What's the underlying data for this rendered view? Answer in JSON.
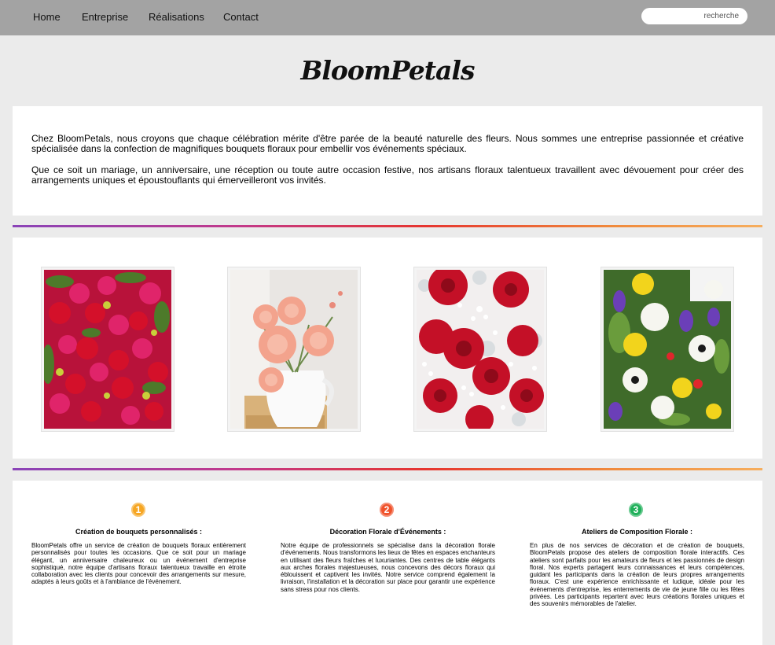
{
  "nav": {
    "items": [
      {
        "label": "Home"
      },
      {
        "label": "Entreprise"
      },
      {
        "label": "Réalisations"
      },
      {
        "label": "Contact"
      }
    ],
    "search_placeholder": "recherche"
  },
  "brand": {
    "name": "BloomPetals"
  },
  "intro": {
    "paragraphs": [
      "Chez BloomPetals, nous croyons que chaque célébration mérite d'être parée de la beauté naturelle des fleurs. Nous sommes une entreprise passionnée et créative spécialisée dans la confection de magnifiques bouquets floraux pour embellir vos événements spéciaux.",
      "Que ce soit un mariage, un anniversaire, une réception ou toute autre occasion festive, nos artisans floraux talentueux travaillent avec dévouement pour créer des arrangements uniques et époustouflants qui émerveilleront vos invités."
    ]
  },
  "gallery": {
    "photos": [
      {
        "icon": "roses-bouquet-photo"
      },
      {
        "icon": "dahlias-vase-photo"
      },
      {
        "icon": "red-roses-gypsophila-photo"
      },
      {
        "icon": "mixed-flowers-photo"
      }
    ]
  },
  "services": [
    {
      "number": "1",
      "color": "#f6a623",
      "title": "Création de bouquets personnalisés :",
      "text": "BloomPetals offre un service de création de bouquets floraux entièrement personnalisés pour toutes les occasions. Que ce soit pour un mariage élégant, un anniversaire chaleureux ou un événement d'entreprise sophistiqué, notre équipe d'artisans floraux talentueux travaille en étroite collaboration avec les clients pour concevoir des arrangements sur mesure, adaptés à leurs goûts et à l'ambiance de l'événement."
    },
    {
      "number": "2",
      "color": "#f0522b",
      "title": "Décoration Florale d'Événements :",
      "text": "Notre équipe de professionnels se spécialise dans la décoration florale d'événements. Nous transformons les lieux de fêtes en espaces enchanteurs en utilisant des fleurs fraîches et luxuriantes. Des centres de table élégants aux arches florales majestueuses, nous concevons des décors floraux qui éblouissent et captivent les invités. Notre service comprend également la livraison, l'installation et la décoration sur place pour garantir une expérience sans stress pour nos clients."
    },
    {
      "number": "3",
      "color": "#1fb05a",
      "title": "Ateliers de Composition Florale :",
      "text": "En plus de nos services de décoration et de création de bouquets, BloomPetals propose des ateliers de composition florale interactifs. Ces ateliers sont parfaits pour les amateurs de fleurs et les passionnés de design floral. Nos experts partagent leurs connaissances et leurs compétences, guidant les participants dans la création de leurs propres arrangements floraux. C'est une expérience enrichissante et ludique, idéale pour les événements d'entreprise, les enterrements de vie de jeune fille ou les fêtes privées. Les participants repartent avec leurs créations florales uniques et des souvenirs mémorables de l'atelier."
    }
  ]
}
